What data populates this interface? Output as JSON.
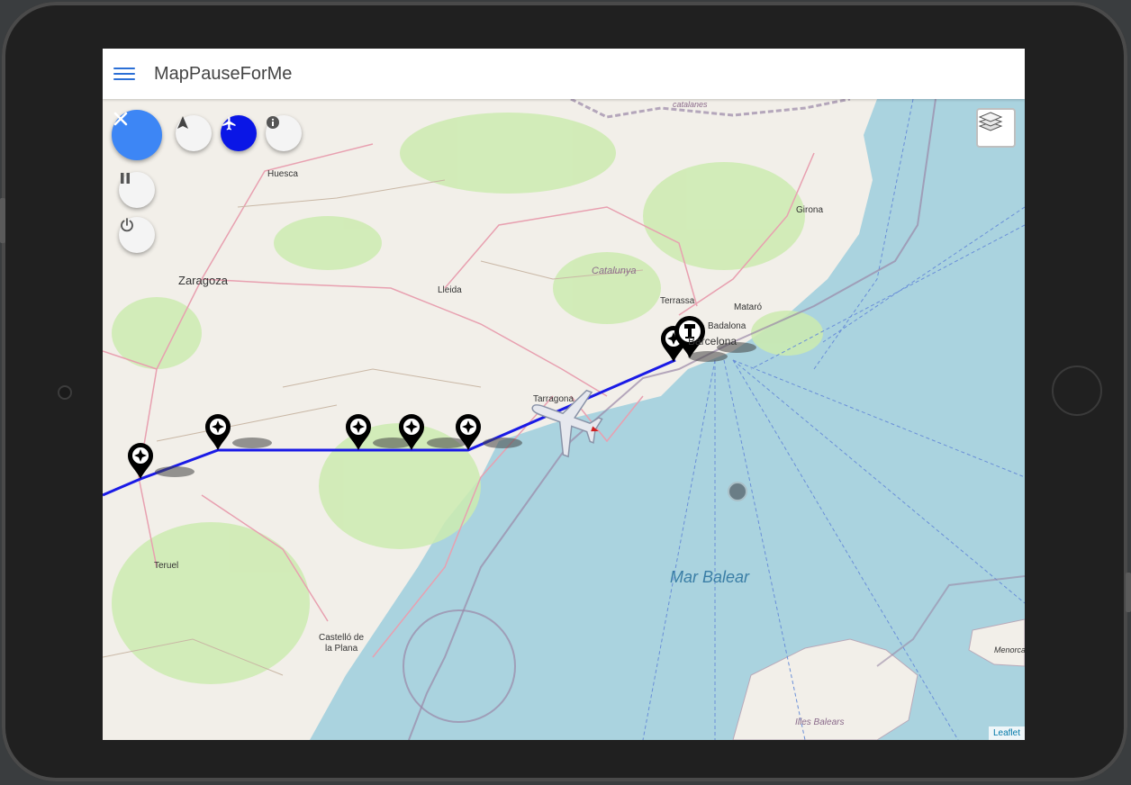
{
  "app": {
    "title": "MapPauseForMe"
  },
  "map": {
    "labels": {
      "huesca": "Huesca",
      "zaragoza": "Zaragoza",
      "lleida": "Lleida",
      "catalunya": "Catalunya",
      "terrassa": "Terrassa",
      "mataro": "Mataró",
      "badalona": "Badalona",
      "barcelona": "Barcelona",
      "girona": "Girona",
      "tarragona": "Tarragona",
      "teruel": "Teruel",
      "castello_1": "Castelló de",
      "castello_2": "la Plana",
      "mar_balear": "Mar Balear",
      "illes_balears": "Illes Balears",
      "menorca": "Menorca",
      "catalanes": "catalanes"
    },
    "attribution": "Leaflet"
  },
  "controls": {
    "close": "close-icon",
    "navigate": "navigation-arrow-icon",
    "plane": "airplane-icon",
    "info": "info-icon",
    "pause": "pause-icon",
    "power": "power-icon",
    "layers": "layers-icon"
  },
  "colors": {
    "route": "#1a1ae6",
    "accent": "#3d86f5",
    "plane_button": "#0a16e6",
    "sea": "#aad3df",
    "land": "#f2efe9"
  }
}
